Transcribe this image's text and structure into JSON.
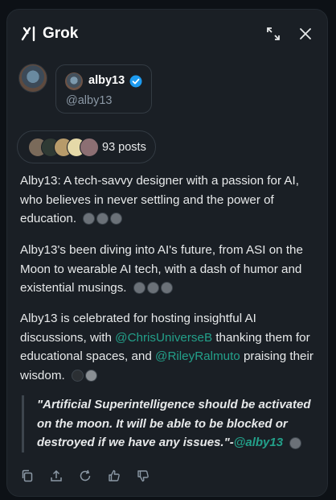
{
  "header": {
    "app_name": "Grok",
    "icons": [
      "grok-logo-icon",
      "expand-icon",
      "close-icon"
    ]
  },
  "profile": {
    "name": "alby13",
    "handle": "@alby13",
    "verified": true
  },
  "posts": {
    "count_label": "93 posts",
    "avatar_colors": [
      "#7a6a5a",
      "#3a4e3f",
      "#b79b6a",
      "#e5d9a8",
      "#8c6f73"
    ]
  },
  "summary": {
    "p1": "Alby13: A tech-savvy designer with a passion for AI, who believes in never settling and the power of education.",
    "p2": "Alby13's been diving into AI's future, from ASI on the Moon to wearable AI tech, with a dash of humor and existential musings.",
    "p3_a": "Alby13 is celebrated for hosting insightful AI discussions, with ",
    "p3_link1": "@ChrisUniverseB",
    "p3_b": " thanking them for educational spaces, and ",
    "p3_link2": "@RileyRalmuto",
    "p3_c": " praising their wisdom."
  },
  "quote": {
    "text": "\"Artificial Superintelligence should be activated on the moon. It will be able to be blocked or destroyed if we have any issues.\"-",
    "author": "@alby13"
  },
  "actions": [
    "copy-icon",
    "share-icon",
    "regenerate-icon",
    "thumbs-up-icon",
    "thumbs-down-icon"
  ],
  "colors": {
    "background": "#1a1f25",
    "text": "#e7e9ea",
    "muted": "#8b98a5",
    "mention": "#23a08a",
    "verified": "#1d9bf0"
  }
}
